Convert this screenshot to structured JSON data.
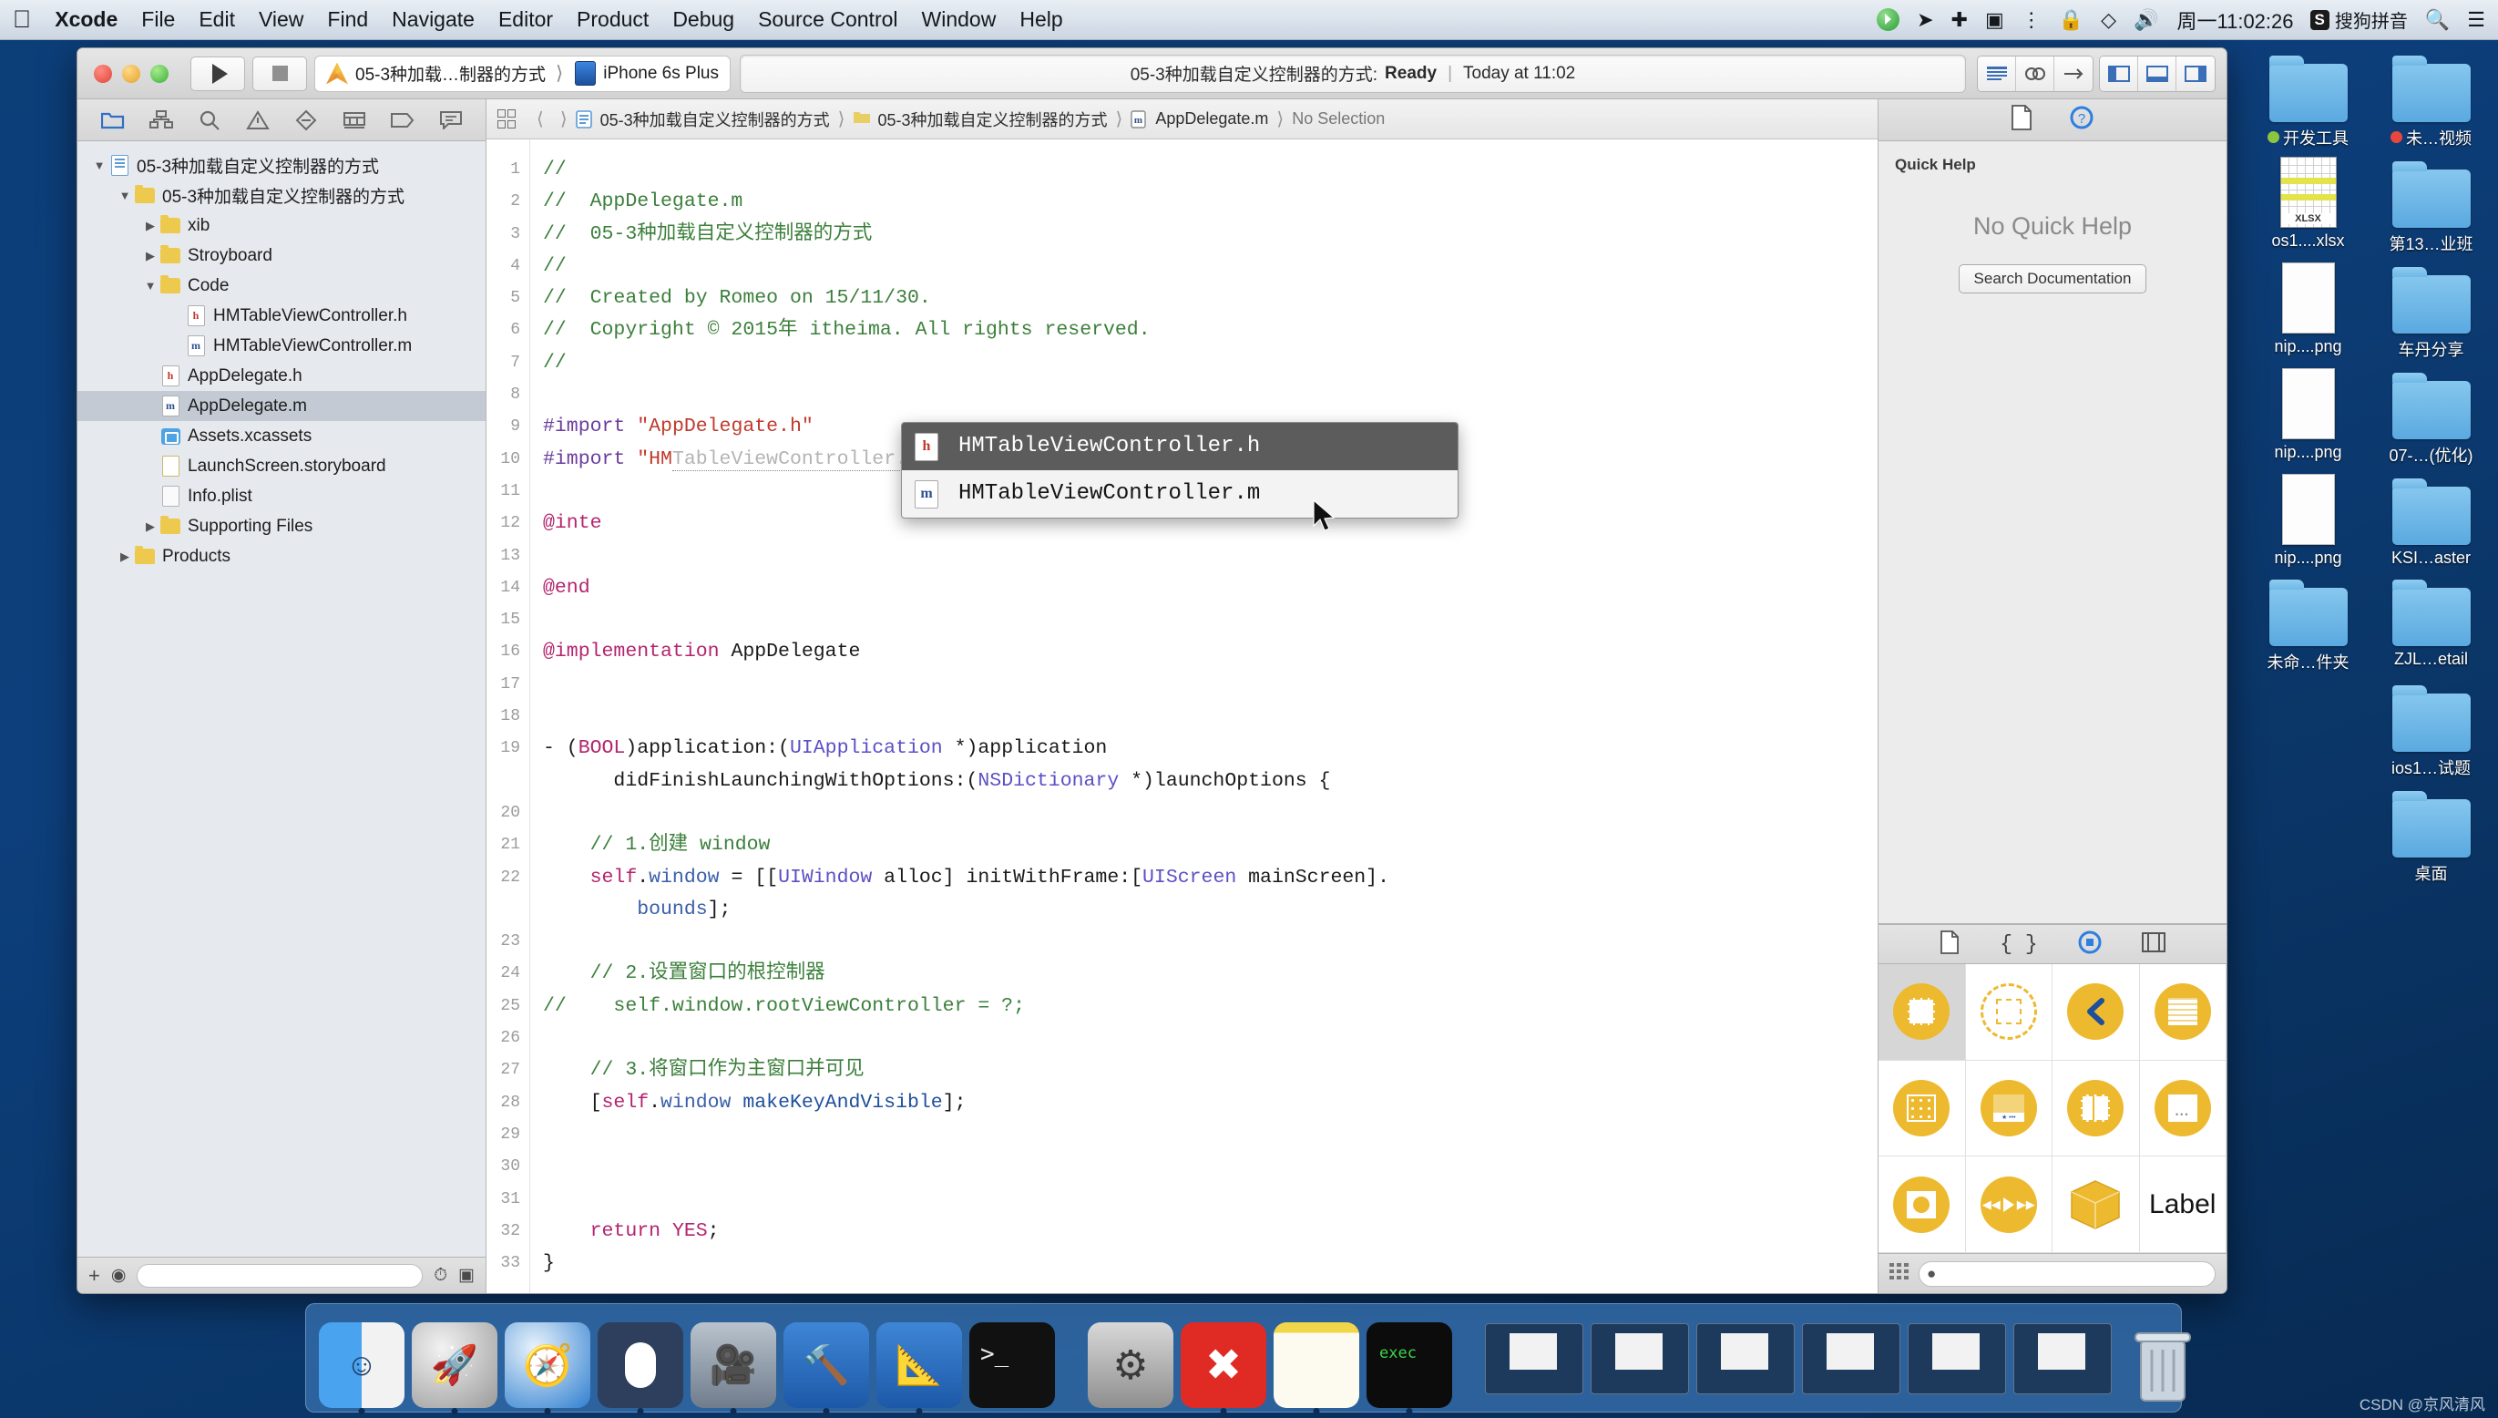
{
  "menubar": {
    "apple_icon": "apple-logo-icon",
    "items": [
      "Xcode",
      "File",
      "Edit",
      "View",
      "Find",
      "Navigate",
      "Editor",
      "Product",
      "Debug",
      "Source Control",
      "Window",
      "Help"
    ],
    "status_icons": [
      "screen-record-icon",
      "location-arrow-icon",
      "bluetooth-icon",
      "video-camera-icon",
      "sound-wave-icon",
      "lock-icon",
      "dropbox-icon",
      "volume-icon"
    ],
    "clock": "周一11:02:26",
    "input_method_badge": "S",
    "input_method": "搜狗拼音",
    "search_icon": "search-icon",
    "list_icon": "control-center-icon"
  },
  "xcode": {
    "toolbar": {
      "run_icon": "play-icon",
      "stop_icon": "stop-icon",
      "scheme_name": "05-3种加载…制器的方式",
      "destination": "iPhone 6s Plus",
      "status_project": "05-3种加载自定义控制器的方式:",
      "status_state": "Ready",
      "status_time": "Today at 11:02",
      "editor_icons": [
        "standard-editor-icon",
        "assistant-editor-icon",
        "version-editor-icon"
      ],
      "view_icons": [
        "toggle-navigator-icon",
        "toggle-debug-area-icon",
        "toggle-utilities-icon"
      ]
    },
    "navigator": {
      "tabs": [
        "project-navigator-icon",
        "symbol-navigator-icon",
        "find-navigator-icon",
        "issue-navigator-icon",
        "test-navigator-icon",
        "debug-navigator-icon",
        "breakpoint-navigator-icon",
        "report-navigator-icon"
      ],
      "tree": [
        {
          "label": "05-3种加载自定义控制器的方式",
          "indent": 0,
          "icon": "project-icon",
          "twist": "open",
          "selected": false
        },
        {
          "label": "05-3种加载自定义控制器的方式",
          "indent": 1,
          "icon": "folder-icon",
          "twist": "open",
          "selected": false
        },
        {
          "label": "xib",
          "indent": 2,
          "icon": "folder-icon",
          "twist": "closed",
          "selected": false
        },
        {
          "label": "Stroyboard",
          "indent": 2,
          "icon": "folder-icon",
          "twist": "closed",
          "selected": false
        },
        {
          "label": "Code",
          "indent": 2,
          "icon": "folder-icon",
          "twist": "open",
          "selected": false
        },
        {
          "label": "HMTableViewController.h",
          "indent": 3,
          "icon": "header-file-icon",
          "twist": "none",
          "selected": false
        },
        {
          "label": "HMTableViewController.m",
          "indent": 3,
          "icon": "source-file-icon",
          "twist": "none",
          "selected": false
        },
        {
          "label": "AppDelegate.h",
          "indent": 2,
          "icon": "header-file-icon",
          "twist": "none",
          "selected": false
        },
        {
          "label": "AppDelegate.m",
          "indent": 2,
          "icon": "source-file-icon",
          "twist": "none",
          "selected": true
        },
        {
          "label": "Assets.xcassets",
          "indent": 2,
          "icon": "assets-icon",
          "twist": "none",
          "selected": false
        },
        {
          "label": "LaunchScreen.storyboard",
          "indent": 2,
          "icon": "storyboard-icon",
          "twist": "none",
          "selected": false
        },
        {
          "label": "Info.plist",
          "indent": 2,
          "icon": "plist-icon",
          "twist": "none",
          "selected": false
        },
        {
          "label": "Supporting Files",
          "indent": 2,
          "icon": "folder-icon",
          "twist": "closed",
          "selected": false
        },
        {
          "label": "Products",
          "indent": 1,
          "icon": "folder-icon",
          "twist": "closed",
          "selected": false
        }
      ],
      "bottom": {
        "add_icon": "plus-icon",
        "filter_icon": "filter-icon",
        "recent_icon": "recent-icon",
        "source-control-icon": "source-control-icon"
      }
    },
    "breadcrumb": {
      "jump_icon": "jump-bar-icon",
      "back_icon": "chevron-left-icon",
      "forward_icon": "chevron-right-icon",
      "items": [
        "05-3种加载自定义控制器的方式",
        "05-3种加载自定义控制器的方式",
        "AppDelegate.m",
        "No Selection"
      ]
    },
    "code": {
      "lines": [
        {
          "n": 1,
          "html": "<span class='c-cm'>//</span>"
        },
        {
          "n": 2,
          "html": "<span class='c-cm'>//  AppDelegate.m</span>"
        },
        {
          "n": 3,
          "html": "<span class='c-cm'>//  05-3种加载自定义控制器的方式</span>"
        },
        {
          "n": 4,
          "html": "<span class='c-cm'>//</span>"
        },
        {
          "n": 5,
          "html": "<span class='c-cm'>//  Created by Romeo on 15/11/30.</span>"
        },
        {
          "n": 6,
          "html": "<span class='c-cm'>//  Copyright © 2015年 itheima. All rights reserved.</span>"
        },
        {
          "n": 7,
          "html": "<span class='c-cm'>//</span>"
        },
        {
          "n": 8,
          "html": ""
        },
        {
          "n": 9,
          "html": "<span class='c-pre'>#import</span> <span class='c-str'>\"AppDelegate.h\"</span>"
        },
        {
          "n": 10,
          "html": "<span class='c-pre'>#import</span> <span class='c-str'>\"H</span><span class='c-str'>M</span><span class='ghost'>TableViewController.h\"</span>"
        },
        {
          "n": 11,
          "html": ""
        },
        {
          "n": 12,
          "html": "<span class='c-kw'>@inte</span>"
        },
        {
          "n": 13,
          "html": ""
        },
        {
          "n": 14,
          "html": "<span class='c-kw'>@end</span>"
        },
        {
          "n": 15,
          "html": ""
        },
        {
          "n": 16,
          "html": "<span class='c-kw'>@implementation</span> AppDelegate"
        },
        {
          "n": 17,
          "html": ""
        },
        {
          "n": 18,
          "html": ""
        },
        {
          "n": 19,
          "html": "- (<span class='c-kw'>BOOL</span>)application:(<span class='c-type'>UIApplication</span> *)application"
        },
        {
          "n": "",
          "html": "      didFinishLaunchingWithOptions:(<span class='c-type'>NSDictionary</span> *)launchOptions {"
        },
        {
          "n": 20,
          "html": ""
        },
        {
          "n": 21,
          "html": "    <span class='c-cm'>// 1.创建 window</span>"
        },
        {
          "n": 22,
          "html": "    <span class='c-kw'>self</span>.<span class='c-prop'>window</span> = [[<span class='c-type'>UIWindow</span> alloc] initWithFrame:[<span class='c-type'>UIScreen</span> mainScreen]."
        },
        {
          "n": "",
          "html": "        <span class='c-prop'>bounds</span>];"
        },
        {
          "n": 23,
          "html": ""
        },
        {
          "n": 24,
          "html": "    <span class='c-cm'>// 2.设置窗口的根控制器</span>"
        },
        {
          "n": 25,
          "html": "<span class='c-cm'>//    self.window.rootViewController = ?;</span>"
        },
        {
          "n": 26,
          "html": ""
        },
        {
          "n": 27,
          "html": "    <span class='c-cm'>// 3.将窗口作为主窗口并可见</span>"
        },
        {
          "n": 28,
          "html": "    [<span class='c-kw'>self</span>.<span class='c-prop'>window</span> <span class='c-msg'>makeKeyAndVisible</span>];"
        },
        {
          "n": 29,
          "html": ""
        },
        {
          "n": 30,
          "html": ""
        },
        {
          "n": 31,
          "html": ""
        },
        {
          "n": 32,
          "html": "    <span class='c-kw'>return</span> <span class='c-kw'>YES</span>;"
        },
        {
          "n": 33,
          "html": "}"
        }
      ]
    },
    "autocomplete": {
      "items": [
        {
          "label": "HMTableViewController.h",
          "kind": "h",
          "active": true
        },
        {
          "label": "HMTableViewController.m",
          "kind": "m",
          "active": false
        }
      ]
    },
    "inspector": {
      "tabs": [
        "file-inspector-icon",
        "quick-help-inspector-icon"
      ],
      "quick_help_title": "Quick Help",
      "quick_help_empty": "No Quick Help",
      "search_documentation": "Search Documentation",
      "library_tabs": [
        "file-template-library-icon",
        "code-snippet-library-icon",
        "object-library-icon",
        "media-library-icon"
      ],
      "library_items": [
        {
          "name": "view-controller-object",
          "selected": true
        },
        {
          "name": "storyboard-reference-object",
          "selected": false
        },
        {
          "name": "navigation-controller-object",
          "selected": false
        },
        {
          "name": "table-view-controller-object",
          "selected": false
        },
        {
          "name": "collection-view-controller-object",
          "selected": false
        },
        {
          "name": "tab-bar-controller-object",
          "selected": false
        },
        {
          "name": "split-view-controller-object",
          "selected": false
        },
        {
          "name": "page-view-controller-object",
          "selected": false
        },
        {
          "name": "glkit-view-controller-object",
          "selected": false
        },
        {
          "name": "avkit-player-controller-object",
          "selected": false
        },
        {
          "name": "object-cube",
          "selected": false
        },
        {
          "name": "label-object",
          "selected": false
        }
      ],
      "library_label_text": "Label",
      "library_bottom": {
        "grid_icon": "grid-view-icon",
        "filter_icon": "filter-icon"
      }
    }
  },
  "desktop": {
    "icons": [
      {
        "label": "开发工具",
        "type": "folder",
        "dot": "#8cc63e"
      },
      {
        "label": "未…视频",
        "type": "folder",
        "dot": "#e8473f"
      },
      {
        "label": "os1....xlsx",
        "type": "xlsx",
        "dot": ""
      },
      {
        "label": "第13…业班",
        "type": "folder",
        "dot": ""
      },
      {
        "label": "nip....png",
        "type": "snip",
        "dot": ""
      },
      {
        "label": "车丹分享",
        "type": "folder",
        "dot": ""
      },
      {
        "label": "nip....png",
        "type": "snip",
        "dot": ""
      },
      {
        "label": "07-…(优化)",
        "type": "folder",
        "dot": ""
      },
      {
        "label": "nip....png",
        "type": "snip",
        "dot": ""
      },
      {
        "label": "KSI…aster",
        "type": "folder",
        "dot": ""
      },
      {
        "label": "未命…件夹",
        "type": "folder",
        "dot": ""
      },
      {
        "label": "ZJL…etail",
        "type": "folder",
        "dot": ""
      },
      {
        "label": "",
        "type": "blank",
        "dot": ""
      },
      {
        "label": "ios1…试题",
        "type": "folder",
        "dot": ""
      },
      {
        "label": "",
        "type": "blank",
        "dot": ""
      },
      {
        "label": "桌面",
        "type": "folder",
        "dot": ""
      }
    ]
  },
  "dock": {
    "items": [
      {
        "name": "finder-icon",
        "running": true
      },
      {
        "name": "launchpad-icon",
        "running": true
      },
      {
        "name": "safari-icon",
        "running": true
      },
      {
        "name": "mouse-app-icon",
        "running": true
      },
      {
        "name": "quicktime-icon",
        "running": true
      },
      {
        "name": "xcode-icon",
        "running": true
      },
      {
        "name": "xcode-beta-icon",
        "running": true
      },
      {
        "name": "terminal-icon",
        "running": false
      },
      {
        "name": "system-preferences-icon",
        "running": false
      },
      {
        "name": "xmind-icon",
        "running": true
      },
      {
        "name": "notes-icon",
        "running": true
      },
      {
        "name": "iterm-icon",
        "running": true
      }
    ],
    "minimized_windows": 6,
    "trash_icon": "trash-icon"
  },
  "watermark": "CSDN @京风清风"
}
